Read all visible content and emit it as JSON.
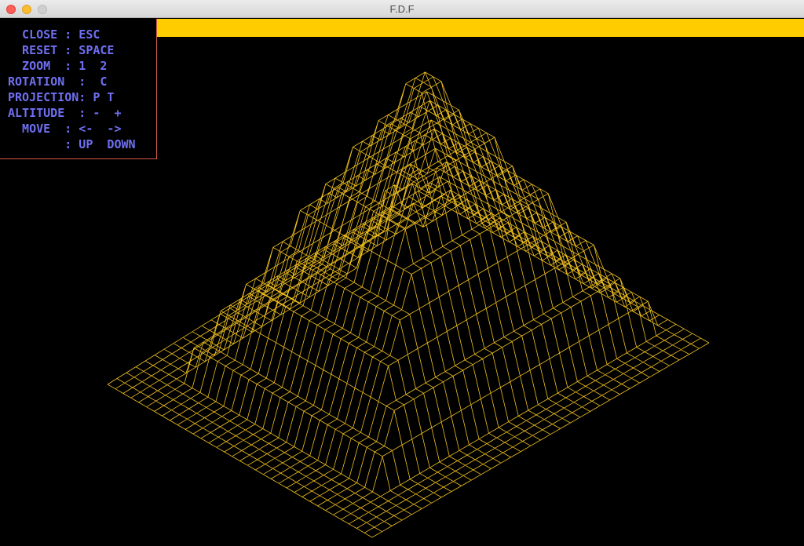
{
  "window": {
    "title": "F.D.F"
  },
  "help": {
    "lines": [
      "  CLOSE : ESC",
      "  RESET : SPACE",
      "  ZOOM  : 1  2",
      "ROTATION  :  C",
      "PROJECTION: P T",
      "ALTITUDE  : -  +",
      "  MOVE  : <-  ->",
      "        : UP  DOWN"
    ]
  },
  "colors": {
    "wire": "#f0c020",
    "help_text": "#6f6ff2",
    "panel_border": "#d85b4a",
    "top_bar": "#ffcc00"
  },
  "icons": {
    "close": "close-button",
    "minimize": "minimize-button",
    "zoom": "zoom-button"
  }
}
